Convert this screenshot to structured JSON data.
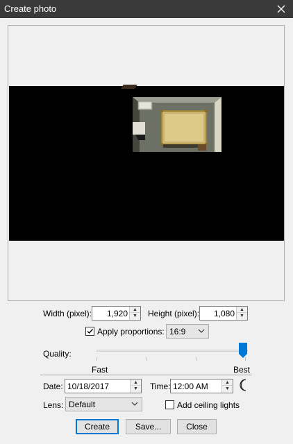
{
  "window": {
    "title": "Create photo",
    "close_icon": "close-icon"
  },
  "size": {
    "width_label": "Width (pixel):",
    "width_value": "1,920",
    "height_label": "Height (pixel):",
    "height_value": "1,080"
  },
  "proportions": {
    "checkbox_label": "Apply proportions:",
    "checked": true,
    "ratio_value": "16:9"
  },
  "quality": {
    "label": "Quality:",
    "min_label": "Fast",
    "max_label": "Best",
    "level_fraction": 1.0
  },
  "datetime": {
    "date_label": "Date:",
    "date_value": "10/18/2017",
    "time_label": "Time:",
    "time_value": "12:00 AM",
    "moon_icon": "moon-icon"
  },
  "lens": {
    "label": "Lens:",
    "value": "Default"
  },
  "ceiling_lights": {
    "label": "Add ceiling lights",
    "checked": false
  },
  "buttons": {
    "create": "Create",
    "save": "Save...",
    "close": "Close"
  },
  "colors": {
    "titlebar": "#3a3a3a",
    "accent": "#0078d7",
    "preview_bg": "#000000"
  }
}
